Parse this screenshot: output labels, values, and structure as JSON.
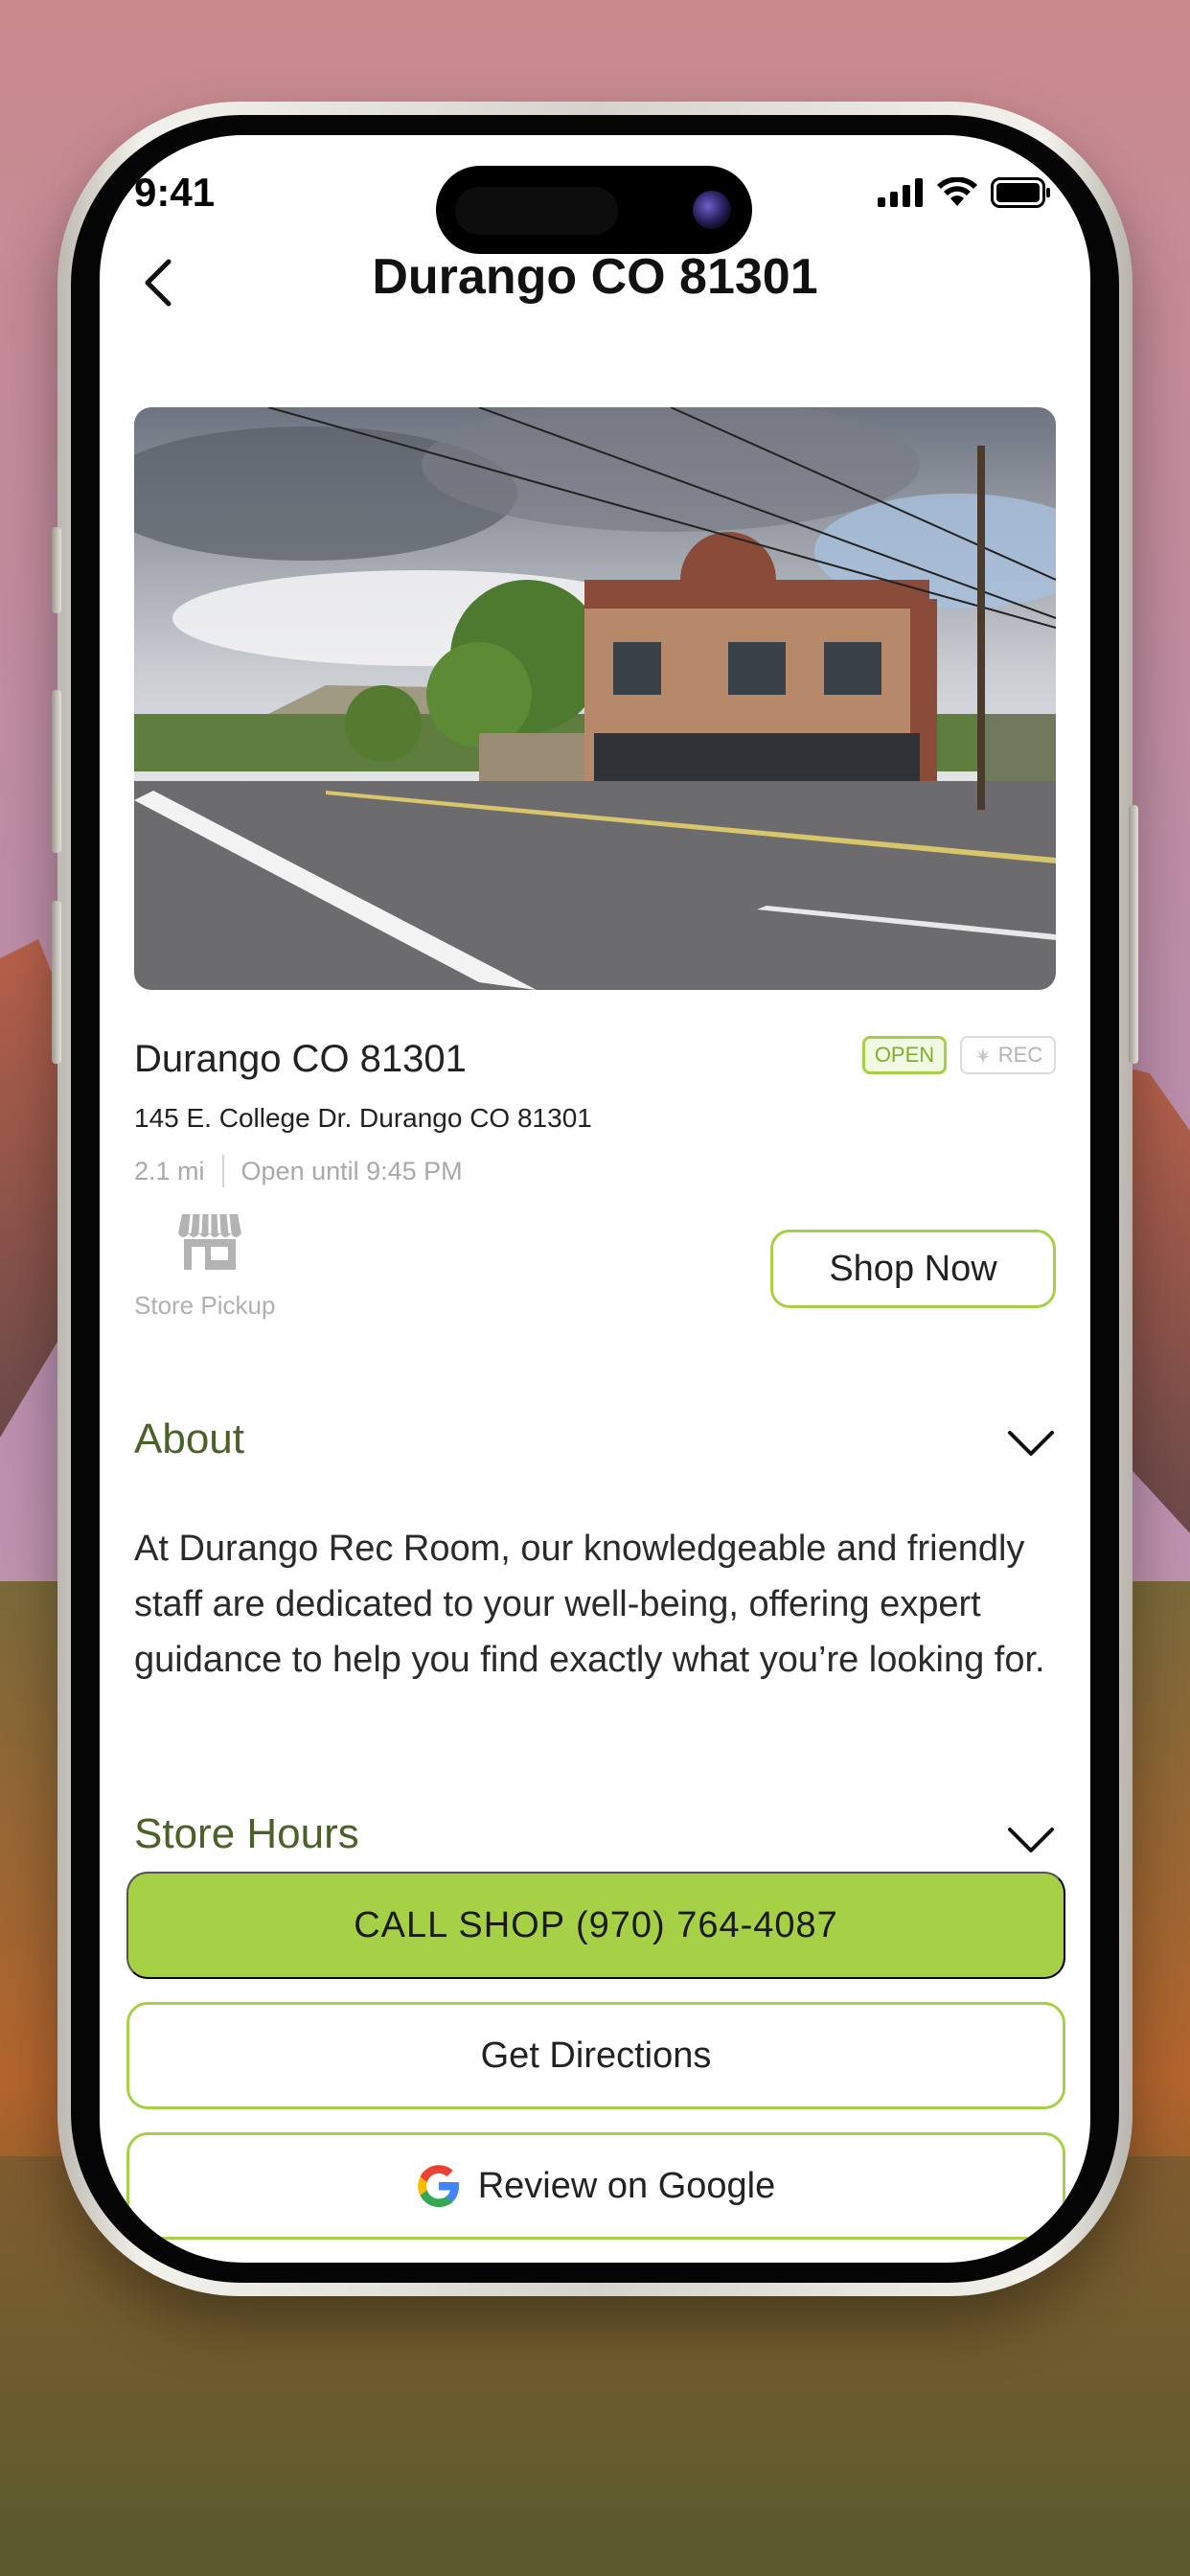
{
  "status_bar": {
    "time": "9:41"
  },
  "header": {
    "title": "Durango CO 81301"
  },
  "store": {
    "name": "Durango CO 81301",
    "status_badge": "OPEN",
    "type_badge": "REC",
    "address": "145 E. College Dr. Durango CO 81301",
    "distance": "2.1 mi",
    "hours_summary": "Open until 9:45 PM",
    "pickup_label": "Store Pickup",
    "shop_now_label": "Shop Now"
  },
  "about": {
    "heading": "About",
    "text": "At Durango Rec Room, our knowledgeable and friendly staff are dedicated to your well-being, offering expert guidance to help you find exactly what you’re looking for."
  },
  "store_hours": {
    "heading": "Store Hours"
  },
  "actions": {
    "call_label": "CALL SHOP (970) 764-4087",
    "directions_label": "Get Directions",
    "review_label": "Review on Google"
  },
  "colors": {
    "accent": "#a6d146",
    "section_heading": "#4a6128",
    "muted_text": "#a9a9a9"
  },
  "icons": [
    "back-chevron-icon",
    "cellular-signal-icon",
    "wifi-icon",
    "battery-icon",
    "cannabis-leaf-icon",
    "storefront-icon",
    "chevron-down-icon",
    "google-g-icon"
  ]
}
